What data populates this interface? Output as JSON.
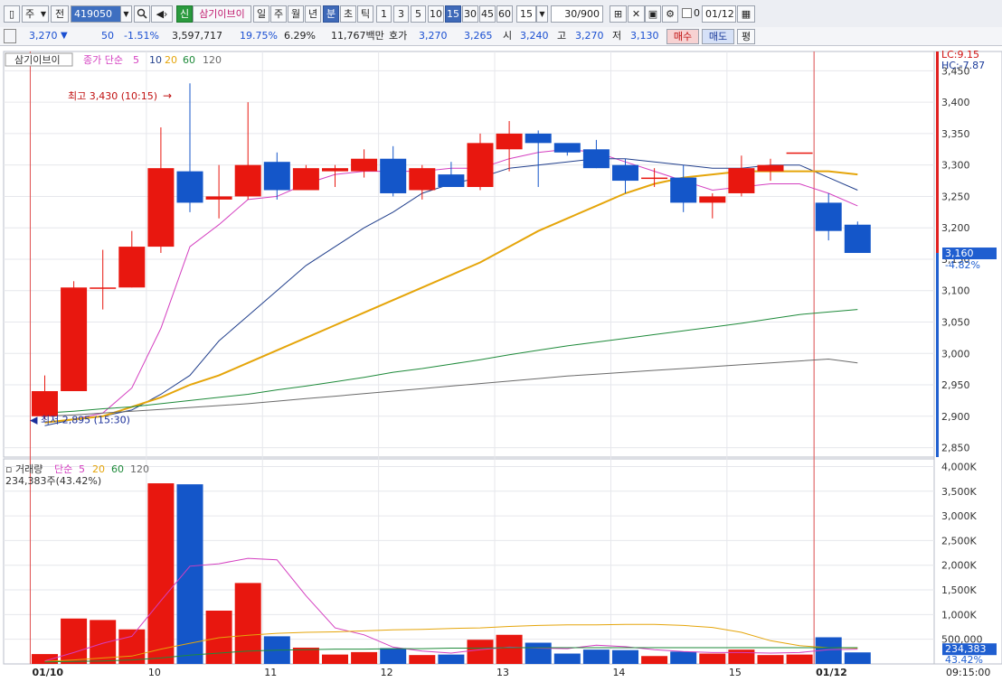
{
  "toolbar": {
    "mode_label": "주",
    "prev_label": "전",
    "code": "419050",
    "stock_new_badge": "신",
    "stock_name": "삼기이브이",
    "periods": [
      "일",
      "주",
      "월",
      "년",
      "분",
      "초",
      "틱"
    ],
    "active_period": "분",
    "intervals": [
      "1",
      "3",
      "5",
      "10",
      "15",
      "30",
      "45",
      "60"
    ],
    "active_interval": "15",
    "interval_value": "15",
    "count_value": "30/900",
    "check_label": "0",
    "date_value": "01/12"
  },
  "info": {
    "price": "3,270",
    "change_arrow": "▼",
    "change": "50",
    "change_pct": "-1.51%",
    "volume": "3,597,717",
    "volume_ratio": "19.75%",
    "turnover": "6.29%",
    "amount": "11,767백만",
    "quote_label": "호가",
    "ask": "3,270",
    "bid": "3,265",
    "open_label": "시",
    "open": "3,240",
    "high_label": "고",
    "high": "3,270",
    "low_label": "저",
    "low": "3,130",
    "buy_label": "매수",
    "sell_label": "매도",
    "avg_label": "평"
  },
  "colors": {
    "up": "#e8170f",
    "down": "#1456c9",
    "ma5": "#d43fc0",
    "ma10": "#213f8c",
    "ma20": "#e5a50a",
    "ma60": "#1e8a3a",
    "ma120": "#6a6a6a"
  },
  "chart_data": [
    {
      "type": "candlestick",
      "legend": {
        "name": "삼기이브이",
        "label": "종가 단순",
        "periods": [
          "5",
          "10",
          "20",
          "60",
          "120"
        ]
      },
      "y_ticks": [
        "3,450",
        "3,400",
        "3,350",
        "3,300",
        "3,250",
        "3,200",
        "3,150",
        "3,100",
        "3,050",
        "3,000",
        "2,950",
        "2,900",
        "2,850"
      ],
      "ylim": [
        2835,
        3475
      ],
      "x_labels": [
        {
          "label": "01/10",
          "at": 0
        },
        {
          "label": "10",
          "at": 4
        },
        {
          "label": "11",
          "at": 8
        },
        {
          "label": "12",
          "at": 12
        },
        {
          "label": "13",
          "at": 16
        },
        {
          "label": "14",
          "at": 20
        },
        {
          "label": "15",
          "at": 24
        },
        {
          "label": "01/12",
          "at": 27
        }
      ],
      "candles": [
        {
          "o": 2900,
          "h": 2965,
          "l": 2895,
          "c": 2940
        },
        {
          "o": 2940,
          "h": 3115,
          "l": 2940,
          "c": 3105
        },
        {
          "o": 3105,
          "h": 3165,
          "l": 3070,
          "c": 3105
        },
        {
          "o": 3105,
          "h": 3195,
          "l": 3105,
          "c": 3170
        },
        {
          "o": 3170,
          "h": 3360,
          "l": 3160,
          "c": 3295
        },
        {
          "o": 3290,
          "h": 3430,
          "l": 3225,
          "c": 3240
        },
        {
          "o": 3245,
          "h": 3300,
          "l": 3215,
          "c": 3250
        },
        {
          "o": 3250,
          "h": 3400,
          "l": 3245,
          "c": 3300
        },
        {
          "o": 3305,
          "h": 3320,
          "l": 3245,
          "c": 3260
        },
        {
          "o": 3260,
          "h": 3300,
          "l": 3260,
          "c": 3295
        },
        {
          "o": 3290,
          "h": 3300,
          "l": 3265,
          "c": 3295
        },
        {
          "o": 3290,
          "h": 3325,
          "l": 3280,
          "c": 3310
        },
        {
          "o": 3310,
          "h": 3330,
          "l": 3250,
          "c": 3255
        },
        {
          "o": 3260,
          "h": 3300,
          "l": 3245,
          "c": 3295
        },
        {
          "o": 3285,
          "h": 3305,
          "l": 3265,
          "c": 3265
        },
        {
          "o": 3265,
          "h": 3350,
          "l": 3260,
          "c": 3335
        },
        {
          "o": 3325,
          "h": 3370,
          "l": 3290,
          "c": 3350
        },
        {
          "o": 3350,
          "h": 3355,
          "l": 3265,
          "c": 3335
        },
        {
          "o": 3335,
          "h": 3330,
          "l": 3315,
          "c": 3320
        },
        {
          "o": 3325,
          "h": 3340,
          "l": 3295,
          "c": 3295
        },
        {
          "o": 3300,
          "h": 3310,
          "l": 3255,
          "c": 3275
        },
        {
          "o": 3280,
          "h": 3295,
          "l": 3265,
          "c": 3280
        },
        {
          "o": 3280,
          "h": 3300,
          "l": 3225,
          "c": 3240
        },
        {
          "o": 3240,
          "h": 3255,
          "l": 3215,
          "c": 3250
        },
        {
          "o": 3255,
          "h": 3315,
          "l": 3250,
          "c": 3295
        },
        {
          "o": 3290,
          "h": 3310,
          "l": 3275,
          "c": 3300
        },
        {
          "o": 3320,
          "h": 3320,
          "l": 3320,
          "c": 3320
        },
        {
          "o": 3240,
          "h": 3255,
          "l": 3180,
          "c": 3195
        },
        {
          "o": 3205,
          "h": 3210,
          "l": 3160,
          "c": 3160
        }
      ],
      "ma": {
        "5": [
          2890,
          2895,
          2905,
          2945,
          3040,
          3170,
          3205,
          3245,
          3250,
          3270,
          3285,
          3290,
          3290,
          3290,
          3295,
          3295,
          3310,
          3320,
          3325,
          3320,
          3305,
          3290,
          3275,
          3260,
          3265,
          3270,
          3270,
          3255,
          3235
        ],
        "10": [
          2885,
          2895,
          2900,
          2910,
          2935,
          2965,
          3020,
          3060,
          3100,
          3140,
          3170,
          3200,
          3225,
          3255,
          3270,
          3280,
          3295,
          3300,
          3305,
          3310,
          3310,
          3305,
          3300,
          3295,
          3295,
          3300,
          3300,
          3280,
          3260
        ],
        "20": [
          2890,
          2895,
          2900,
          2915,
          2930,
          2950,
          2965,
          2985,
          3005,
          3025,
          3045,
          3065,
          3085,
          3105,
          3125,
          3145,
          3170,
          3195,
          3215,
          3235,
          3255,
          3270,
          3280,
          3285,
          3290,
          3290,
          3290,
          3290,
          3285
        ],
        "60": [
          2905,
          2908,
          2912,
          2915,
          2920,
          2925,
          2930,
          2935,
          2942,
          2948,
          2955,
          2962,
          2970,
          2976,
          2983,
          2990,
          2998,
          3005,
          3012,
          3018,
          3024,
          3030,
          3036,
          3042,
          3048,
          3055,
          3062,
          3066,
          3070
        ],
        "120": [
          2900,
          2902,
          2905,
          2908,
          2911,
          2914,
          2917,
          2920,
          2924,
          2928,
          2932,
          2936,
          2940,
          2944,
          2948,
          2952,
          2956,
          2960,
          2964,
          2967,
          2970,
          2973,
          2976,
          2979,
          2982,
          2985,
          2988,
          2991,
          2985
        ]
      },
      "annotations": {
        "high_label": "최고 3,430 (10:15)",
        "low_label": "최저 2,895 (15:30)",
        "lc_label": "LC:9.15",
        "hc_label": "HC:-7.87",
        "current_price": "3,160",
        "current_pct": "-4.82%"
      }
    },
    {
      "type": "bar",
      "legend": {
        "name": "거래량",
        "label": "단순",
        "periods": [
          "5",
          "20",
          "60",
          "120"
        ]
      },
      "summary_label": "234,383주(43.42%)",
      "y_ticks": [
        "4,000K",
        "3,500K",
        "3,000K",
        "2,500K",
        "2,000K",
        "1,500K",
        "1,000K",
        "500,000"
      ],
      "ylim": [
        0,
        4100
      ],
      "volumes": [
        200,
        920,
        890,
        700,
        3660,
        3640,
        1080,
        1640,
        560,
        330,
        190,
        240,
        320,
        180,
        190,
        490,
        590,
        430,
        210,
        290,
        280,
        160,
        250,
        210,
        290,
        180,
        190,
        540,
        234
      ],
      "ma5": [
        60,
        230,
        420,
        560,
        1280,
        1980,
        2030,
        2140,
        2110,
        1380,
        730,
        590,
        340,
        260,
        220,
        290,
        340,
        320,
        310,
        380,
        350,
        290,
        250,
        230,
        230,
        220,
        230,
        290,
        300
      ],
      "ma20": [
        50,
        80,
        120,
        160,
        300,
        420,
        530,
        580,
        620,
        640,
        650,
        670,
        690,
        700,
        720,
        730,
        760,
        780,
        790,
        790,
        800,
        800,
        780,
        740,
        640,
        470,
        370,
        330,
        320
      ],
      "ma60": [
        40,
        50,
        60,
        80,
        120,
        180,
        220,
        260,
        280,
        290,
        300,
        300,
        310,
        310,
        320,
        320,
        330,
        330,
        330,
        330,
        330,
        330,
        330,
        330,
        330,
        330,
        330,
        330,
        330
      ],
      "current_value": "234,383",
      "current_pct": "43.42%",
      "time_label": "09:15:00"
    }
  ]
}
